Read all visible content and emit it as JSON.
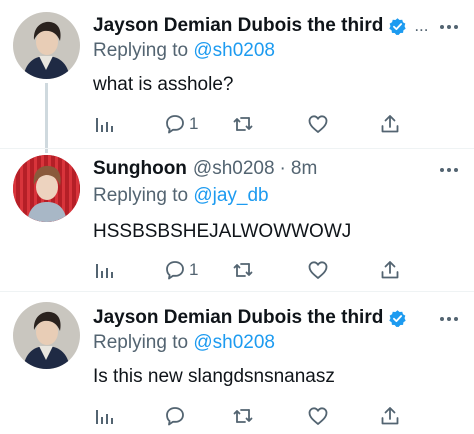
{
  "tweets": [
    {
      "author_name": "Jayson Demian Dubois the third",
      "verified": true,
      "header_truncation": "...",
      "replying_prefix": "Replying to",
      "replying_to": "@sh0208",
      "text": "what is asshole?",
      "reply_count": "1",
      "avatar": "avatar-photo-jayson"
    },
    {
      "author_name": "Sunghoon",
      "author_handle": "@sh0208",
      "separator": "·",
      "timestamp": "8m",
      "replying_prefix": "Replying to",
      "replying_to": "@jay_db",
      "text": "HSSBSBSHEJALWOWWOWJ",
      "reply_count": "1",
      "avatar": "avatar-photo-sunghoon"
    },
    {
      "author_name": "Jayson Demian Dubois the third",
      "verified": true,
      "replying_prefix": "Replying to",
      "replying_to": "@sh0208",
      "text": "Is this new slangdsnsnanasz",
      "reply_count": "",
      "avatar": "avatar-photo-jayson"
    }
  ],
  "icons": {
    "analytics": "bar-chart-icon",
    "reply": "speech-bubble-icon",
    "retweet": "retweet-arrows-icon",
    "like": "heart-icon",
    "share": "share-upload-icon",
    "more": "more-dots-icon",
    "verified": "verified-badge-icon"
  },
  "colors": {
    "accent": "#1d9bf0",
    "secondary_text": "#536471",
    "primary_text": "#0f1419",
    "thread_line": "#cfd9de"
  }
}
